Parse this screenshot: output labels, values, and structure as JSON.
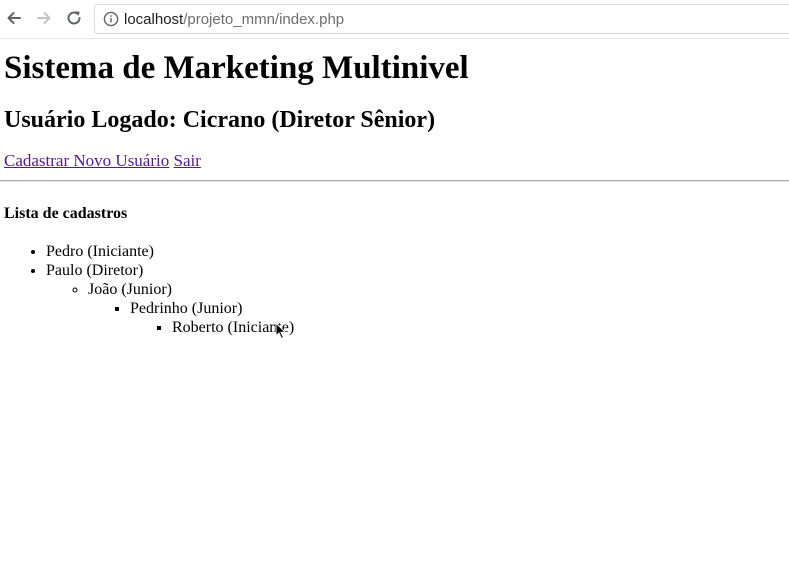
{
  "browser": {
    "url_host": "localhost",
    "url_path": "/projeto_mmn/index.php",
    "icons": {
      "back": "arrow-left-icon",
      "forward": "arrow-right-icon",
      "reload": "reload-icon",
      "info": "info-icon"
    }
  },
  "page": {
    "title": "Sistema de Marketing Multinivel",
    "user_heading": "Usuário Logado: Cicrano (Diretor Sênior)",
    "links": {
      "register": "Cadastrar Novo Usuário",
      "logout": "Sair"
    },
    "list_title": "Lista de cadastros",
    "tree": [
      {
        "label": "Pedro (Iniciante)"
      },
      {
        "label": "Paulo (Diretor)",
        "children": [
          {
            "label": "João (Junior)",
            "children": [
              {
                "label": "Pedrinho (Junior)",
                "children": [
                  {
                    "label": "Roberto (Iniciante)"
                  }
                ]
              }
            ]
          }
        ]
      }
    ]
  },
  "colors": {
    "link_visited": "#551a8b",
    "url_path_gray": "#6e6e6e"
  }
}
